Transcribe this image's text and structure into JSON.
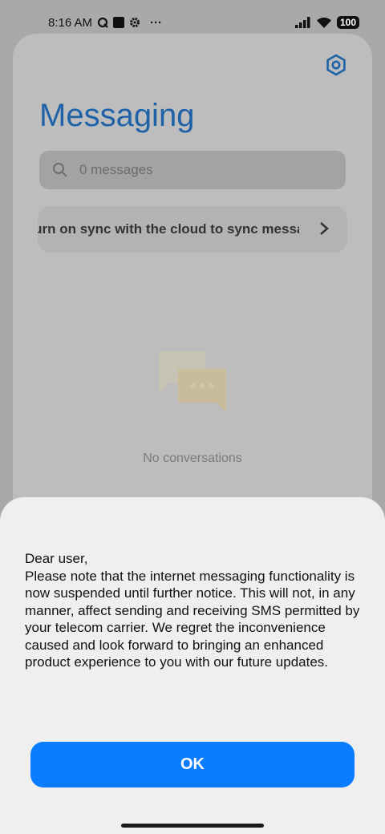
{
  "status_bar": {
    "time": "8:16 AM",
    "battery": "100",
    "more": "···"
  },
  "app": {
    "title": "Messaging",
    "search_placeholder": "0 messages",
    "sync_banner": "Turn on sync with the cloud to sync messages",
    "empty_state": "No conversations",
    "accent": "#1f62a8"
  },
  "dialog": {
    "message": "Dear user,\nPlease note that the internet messaging functionality is now suspended until further notice. This will not, in any manner, affect sending and receiving SMS permitted by your telecom carrier. We regret the inconvenience caused and look forward to bringing an enhanced product experience to you with our future updates.",
    "ok_label": "OK",
    "button_color": "#0a7cff"
  }
}
